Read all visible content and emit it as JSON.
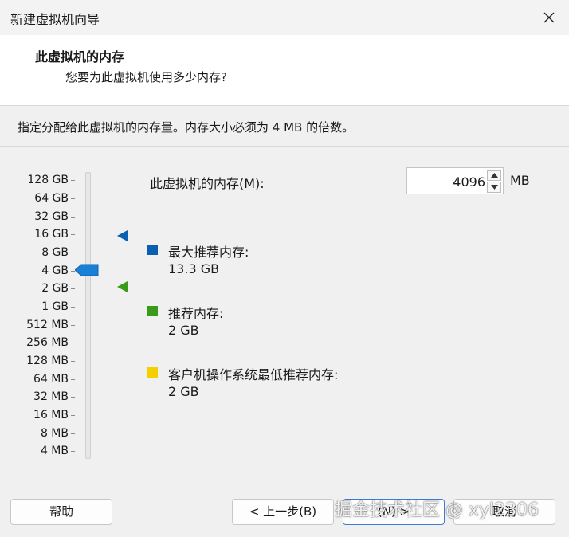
{
  "window": {
    "title": "新建虚拟机向导"
  },
  "header": {
    "title": "此虚拟机的内存",
    "subtitle": "您要为此虚拟机使用多少内存?"
  },
  "description": "指定分配给此虚拟机的内存量。内存大小必须为 4 MB 的倍数。",
  "scale_labels": [
    "128 GB",
    "64 GB",
    "32 GB",
    "16 GB",
    "8 GB",
    "4 GB",
    "2 GB",
    "1 GB",
    "512 MB",
    "256 MB",
    "128 MB",
    "64 MB",
    "32 MB",
    "16 MB",
    "8 MB",
    "4 MB"
  ],
  "memory": {
    "label": "此虚拟机的内存(M):",
    "value": "4096",
    "unit": "MB"
  },
  "slider": {
    "selected": "4 GB",
    "max_recommended": "16 GB",
    "recommended": "2 GB"
  },
  "legend": [
    {
      "label": "最大推荐内存:",
      "value": "13.3 GB",
      "color": "#0a5fb0"
    },
    {
      "label": "推荐内存:",
      "value": "2 GB",
      "color": "#3a9a1a"
    },
    {
      "label": "客户机操作系统最低推荐内存:",
      "value": "2 GB",
      "color": "#f5d000"
    }
  ],
  "colors": {
    "thumb": "#1a7fd6",
    "max_marker": "#0a5fb0",
    "rec_marker": "#3a9a1a"
  },
  "buttons": {
    "help": "帮助",
    "back": "< 上一步(B)",
    "next": "(N) >",
    "cancel": "取消"
  },
  "watermark": "掘金技术社区 @ xyl2306"
}
